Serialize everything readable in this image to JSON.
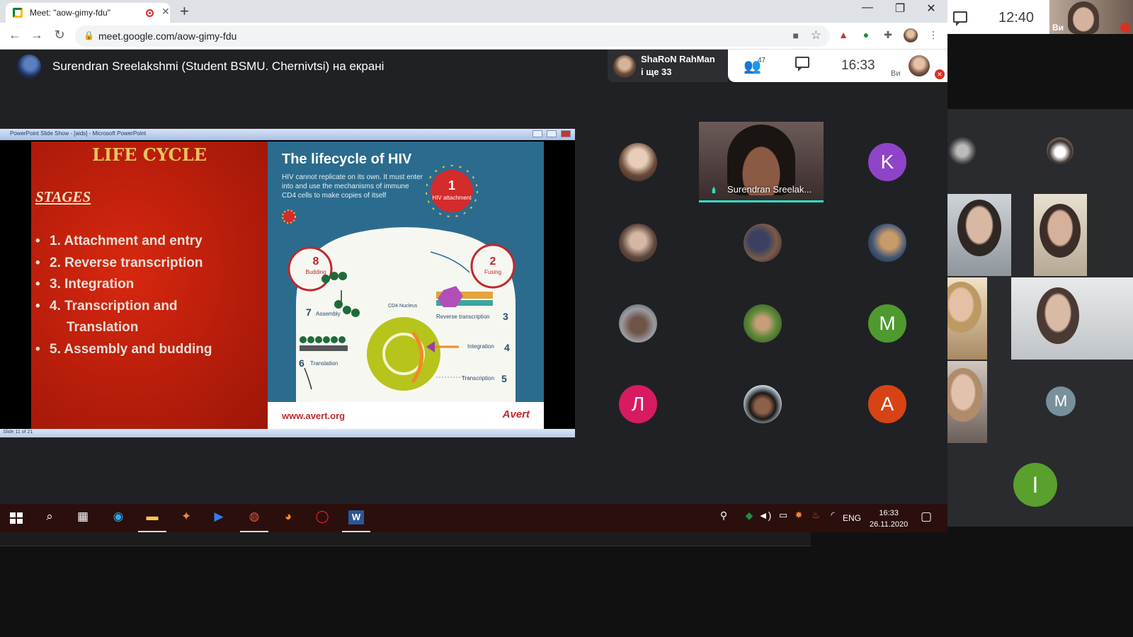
{
  "browser": {
    "tab_title": "Meet: \"aow-gimy-fdu\"",
    "url": "meet.google.com/aow-gimy-fdu"
  },
  "meet": {
    "presenter_text": "Surendran Sreelakshmi (Student BSMU. Chernivtsi) на екрані",
    "pinned_name": "ShaRoN RahMan",
    "pinned_more": "і ще 33",
    "participant_count": "47",
    "clock": "16:33",
    "you_label": "Ви"
  },
  "slide": {
    "window_title": "PowerPoint Slide Show - [aids] - Microsoft PowerPoint",
    "left_title": "LIFE CYCLE",
    "stages_heading": "STAGES",
    "stages": [
      {
        "line1": "1. Attachment and entry",
        "line2": ""
      },
      {
        "line1": "2. Reverse transcription",
        "line2": ""
      },
      {
        "line1": "3. Integration",
        "line2": ""
      },
      {
        "line1": "4. Transcription and",
        "line2": "Translation"
      },
      {
        "line1": "5. Assembly and budding",
        "line2": ""
      }
    ],
    "right_title": "The lifecycle of HIV",
    "right_subtitle": "HIV cannot replicate on its own. It must enter into and use the mechanisms of immune CD4 cells to make copies of itself",
    "diagram": {
      "step1_num": "1",
      "step1": "HIV attachment",
      "step2_num": "2",
      "step2": "Fusing",
      "step3_num": "3",
      "step3": "Reverse transcription",
      "step4_num": "4",
      "step4": "Integration",
      "step5_num": "5",
      "step5": "Transcription",
      "step6_num": "6",
      "step6": "Translation",
      "step7_num": "7",
      "step7": "Assembly",
      "step8_num": "8",
      "step8": "Budding",
      "nucleus": "CD4 Nucleus"
    },
    "footer_url": "www.avert.org",
    "footer_brand": "Avert",
    "status": "Slide 11 of 21"
  },
  "grid": {
    "speaker_name": "Surendran Sreelak...",
    "letters": [
      "K",
      "M",
      "Л",
      "A"
    ]
  },
  "taskbar": {
    "lang": "ENG",
    "time": "16:33",
    "date": "26.11.2020"
  },
  "outer": {
    "clock": "12:40",
    "you_label": "Ви",
    "letters": [
      "M",
      "I"
    ]
  },
  "colors": {
    "meet_bg": "#202124",
    "accent_teal": "#2de0c8",
    "letter_k": "#8e44c9",
    "letter_m": "#4f9a2e",
    "letter_l": "#d81b60",
    "letter_a": "#d84315",
    "outer_m": "#78909c",
    "outer_i": "#5aa02c"
  }
}
